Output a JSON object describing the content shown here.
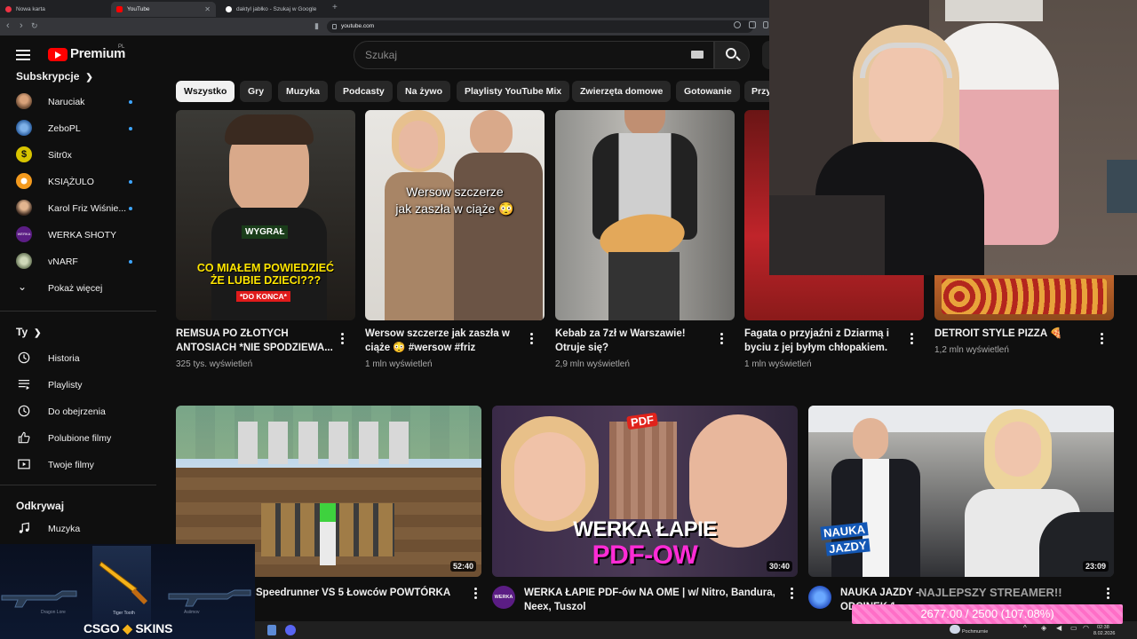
{
  "browser": {
    "tabs": [
      {
        "label": "Nowa karta",
        "active": false
      },
      {
        "label": "YouTube",
        "active": true
      },
      {
        "label": "daktyl jabłko - Szukaj w Google",
        "active": false
      }
    ],
    "url": "youtube.com"
  },
  "youtube": {
    "logo_text": "Premium",
    "country": "PL",
    "search_placeholder": "Szukaj",
    "sidebar": {
      "subscriptions_heading": "Subskrypcje",
      "subscriptions": [
        {
          "name": "Naruciak",
          "new": true
        },
        {
          "name": "ZeboPL",
          "new": true
        },
        {
          "name": "Sitr0x",
          "new": false
        },
        {
          "name": "KSIĄŻULO",
          "new": true
        },
        {
          "name": "Karol Friz Wiśnie...",
          "new": true
        },
        {
          "name": "WERKA SHOTY",
          "new": false
        },
        {
          "name": "vNARF",
          "new": true
        }
      ],
      "show_more": "Pokaż więcej",
      "you_heading": "Ty",
      "you_items": [
        "Historia",
        "Playlisty",
        "Do obejrzenia",
        "Polubione filmy",
        "Twoje filmy"
      ],
      "explore_heading": "Odkrywaj",
      "explore_items": [
        "Muzyka"
      ]
    },
    "chips": [
      "Wszystko",
      "Gry",
      "Muzyka",
      "Podcasty",
      "Na żywo",
      "Playlisty YouTube Mix",
      "Zwierzęta domowe",
      "Gotowanie",
      "Przy"
    ],
    "row1": [
      {
        "title": "REMSUA PO ZŁOTYCH ANTOSIACH *NIE SPODZIEWA...",
        "views": "325 tys. wyświetleń",
        "overlay": [
          "WYGRAŁ",
          "CO MIAŁEM POWIEDZIEĆ",
          "ŻE LUBIE DZIECI???",
          "*DO KONCA*"
        ]
      },
      {
        "title": "Wersow szczerze jak zaszła w ciąże 😳 #wersow #friz",
        "views": "1 mln wyświetleń",
        "overlay": [
          "Wersow szczerze",
          "jak zaszła w ciąże 😳"
        ]
      },
      {
        "title": "Kebab za 7zł w Warszawie! Otruje się?",
        "views": "2,9 mln wyświetleń",
        "overlay": []
      },
      {
        "title": "Fagata o przyjaźni z Dziarmą i byciu z jej byłym chłopakiem.",
        "views": "1 mln wyświetleń",
        "overlay": []
      },
      {
        "title": "DETROIT STYLE PIZZA 🍕",
        "views": "1,2 mln wyświetleń",
        "overlay": []
      }
    ],
    "row2": [
      {
        "title": "Speedrunner VS 5 Łowców POWTÓRKA",
        "duration": "52:40",
        "overlay": []
      },
      {
        "title": "WERKA ŁAPIE PDF-ów NA OME | w/ Nitro, Bandura, Neex, Tuszol",
        "duration": "30:40",
        "channel_badge": "WERKA",
        "overlay": [
          "PDF",
          "WERKA ŁAPIE",
          "PDF-OW"
        ]
      },
      {
        "title": "NAUKA JAZDY - ",
        "title_tail": "ODCINEK 1",
        "duration": "23:09",
        "overlay": [
          "NAUKA",
          "JAZDY"
        ]
      }
    ]
  },
  "stream_overlay": {
    "csgo_brand": "CSGO",
    "csgo_brand2": "SKINS",
    "skins": [
      "Dragon Lore",
      "Tiger Tooth",
      "Asiimov"
    ],
    "ticker": "NAJLEPSZY STREAMER!!",
    "sub_goal": "2677.00 / 2500 (107.08%)",
    "weather": "Pochmurnie",
    "clock": "02:38",
    "date": "8.02.2026"
  },
  "colors": {
    "yt_red": "#ff0000",
    "subscribe_dot": "#3ea6ff",
    "goal_pink": "#ff6ec7",
    "background": "#0f0f0f"
  }
}
